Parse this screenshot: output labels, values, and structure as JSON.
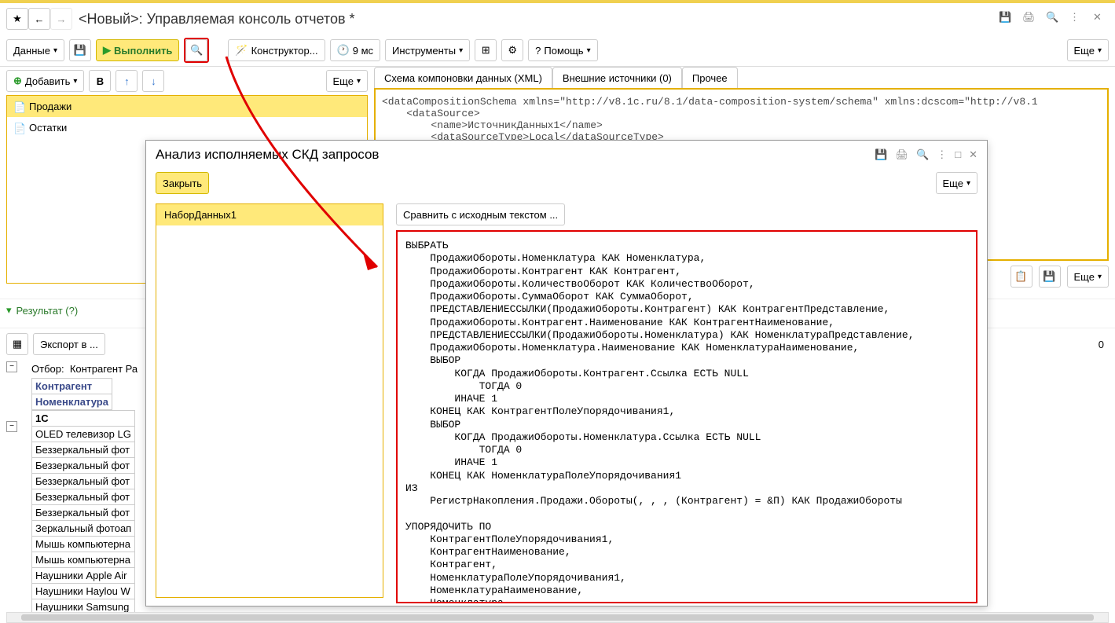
{
  "header": {
    "title": "<Новый>: Управляемая консоль отчетов *"
  },
  "mainToolbar": {
    "data": "Данные",
    "execute": "Выполнить",
    "constructor": "Конструктор...",
    "time": "9 мс",
    "tools": "Инструменты",
    "help": "Помощь",
    "more": "Еще"
  },
  "subToolbar": {
    "add": "Добавить",
    "more": "Еще"
  },
  "sourceList": [
    {
      "label": "Продажи",
      "selected": true
    },
    {
      "label": "Остатки",
      "selected": false
    }
  ],
  "tabs": {
    "schema": "Схема компоновки данных (XML)",
    "external": "Внешние источники (0)",
    "other": "Прочее"
  },
  "xml": "<dataCompositionSchema xmlns=\"http://v8.1c.ru/8.1/data-composition-system/schema\" xmlns:dcscom=\"http://v8.1\n    <dataSource>\n        <name>ИсточникДанных1</name>\n        <dataSourceType>Local</dataSourceType>",
  "rightActions": {
    "more": "Еще"
  },
  "result": {
    "label": "Результат (?)",
    "export": "Экспорт в ...",
    "count": "0"
  },
  "report": {
    "filterPrefix": "Отбор:",
    "filterValue": "Контрагент Ра",
    "col1": "Контрагент",
    "col2": "Номенклатура",
    "cat": "1С",
    "rows": [
      "OLED телевизор LG",
      "Беззеркальный фот",
      "Беззеркальный фот",
      "Беззеркальный фот",
      "Беззеркальный фот",
      "Беззеркальный фот",
      "Зеркальный фотоап",
      "Мышь компьютерна",
      "Мышь компьютерна",
      "Наушники Apple Air",
      "Наушники Haylou W",
      "Наушники Samsung"
    ]
  },
  "dialog": {
    "title": "Анализ исполняемых СКД запросов",
    "close": "Закрыть",
    "more": "Еще",
    "dataset": "НаборДанных1",
    "compare": "Сравнить с исходным текстом ...",
    "sql": "ВЫБРАТЬ\n    ПродажиОбороты.Номенклатура КАК Номенклатура,\n    ПродажиОбороты.Контрагент КАК Контрагент,\n    ПродажиОбороты.КоличествоОборот КАК КоличествоОборот,\n    ПродажиОбороты.СуммаОборот КАК СуммаОборот,\n    ПРЕДСТАВЛЕНИЕССЫЛКИ(ПродажиОбороты.Контрагент) КАК КонтрагентПредставление,\n    ПродажиОбороты.Контрагент.Наименование КАК КонтрагентНаименование,\n    ПРЕДСТАВЛЕНИЕССЫЛКИ(ПродажиОбороты.Номенклатура) КАК НоменклатураПредставление,\n    ПродажиОбороты.Номенклатура.Наименование КАК НоменклатураНаименование,\n    ВЫБОР\n        КОГДА ПродажиОбороты.Контрагент.Ссылка ЕСТЬ NULL\n            ТОГДА 0\n        ИНАЧЕ 1\n    КОНЕЦ КАК КонтрагентПолеУпорядочивания1,\n    ВЫБОР\n        КОГДА ПродажиОбороты.Номенклатура.Ссылка ЕСТЬ NULL\n            ТОГДА 0\n        ИНАЧЕ 1\n    КОНЕЦ КАК НоменклатураПолеУпорядочивания1\nИЗ\n    РегистрНакопления.Продажи.Обороты(, , , (Контрагент) = &П) КАК ПродажиОбороты\n\nУПОРЯДОЧИТЬ ПО\n    КонтрагентПолеУпорядочивания1,\n    КонтрагентНаименование,\n    Контрагент,\n    НоменклатураПолеУпорядочивания1,\n    НоменклатураНаименование,\n    Номенклатура"
  }
}
